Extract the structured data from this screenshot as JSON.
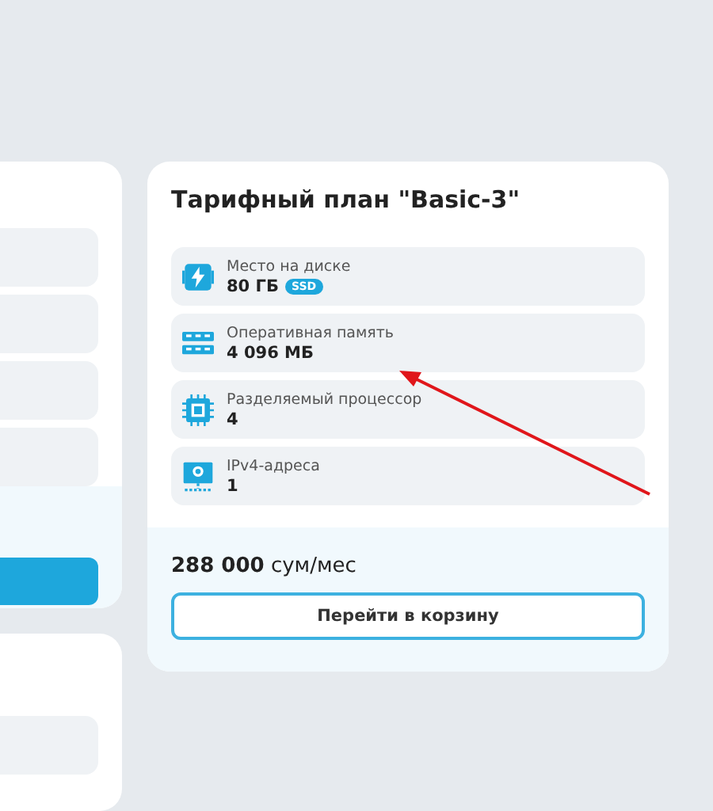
{
  "plan": {
    "title": "Тарифный план \"Basic-3\"",
    "specs": [
      {
        "kind": "disk",
        "label": "Место на диске",
        "value": "80 ГБ",
        "badge": "SSD"
      },
      {
        "kind": "ram",
        "label": "Оперативная память",
        "value": "4 096 МБ"
      },
      {
        "kind": "cpu",
        "label": "Разделяемый процессор",
        "value": "4"
      },
      {
        "kind": "ip",
        "label": "IPv4-адреса",
        "value": "1"
      }
    ],
    "price": "**288 000** сум/мес",
    "button": "Перейти в корзину"
  }
}
